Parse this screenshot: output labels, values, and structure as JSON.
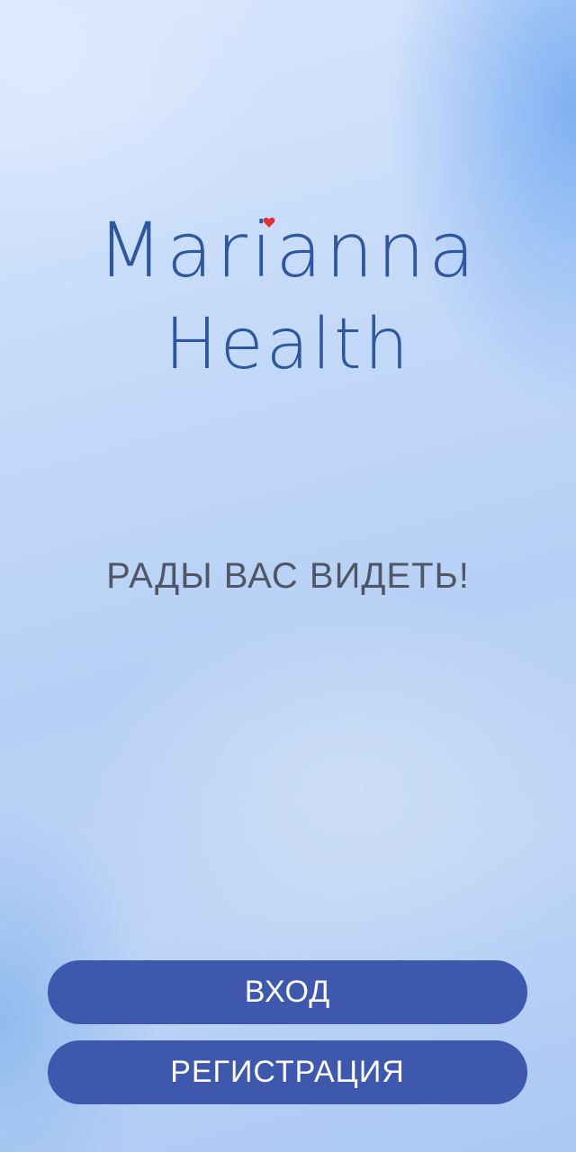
{
  "logo": {
    "line1": "Marianna",
    "line2": "Health",
    "heart_color": "#e0322f",
    "text_color": "#2f57a0"
  },
  "greeting": "РАДЫ ВАС ВИДЕТЬ!",
  "buttons": {
    "login_label": "ВХОД",
    "register_label": "РЕГИСТРАЦИЯ",
    "color": "#3e58ae"
  }
}
